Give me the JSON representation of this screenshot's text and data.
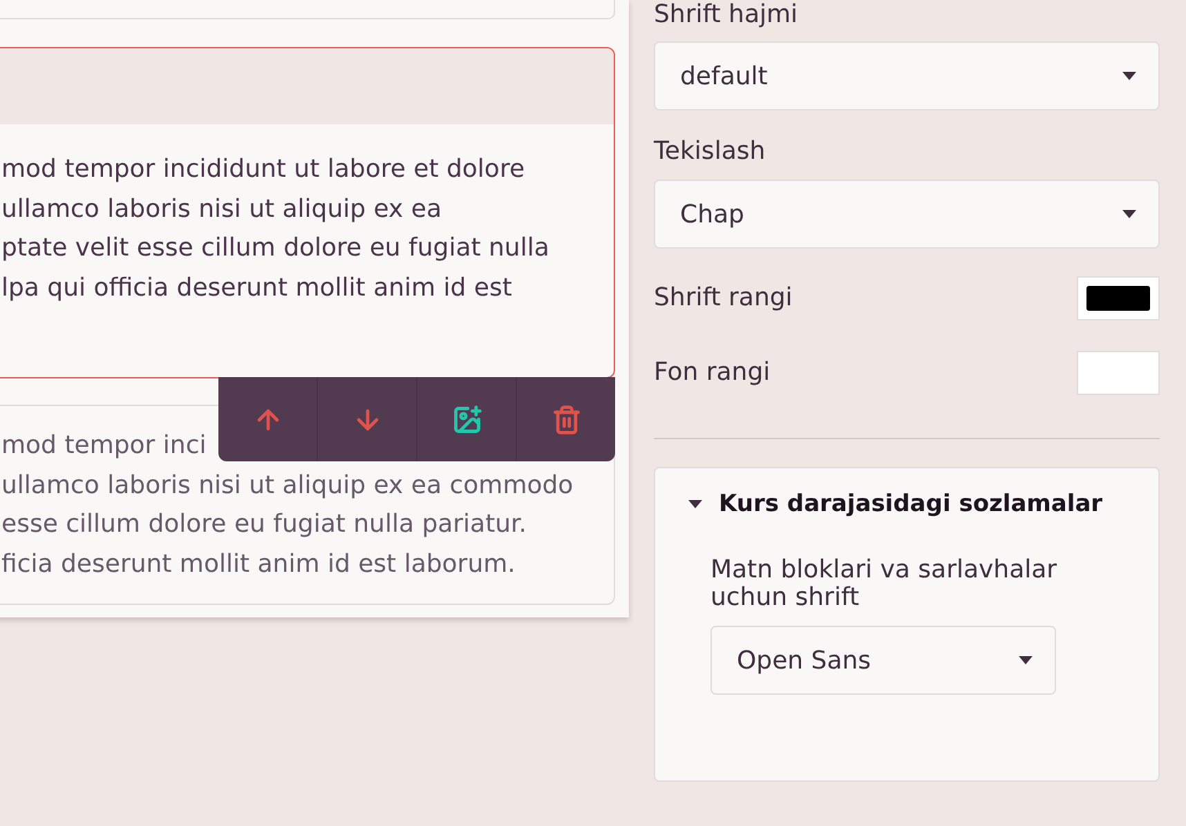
{
  "blocks": [
    {
      "selected": true,
      "lines": [
        "mod tempor incididunt ut labore et dolore",
        "ullamco laboris nisi ut aliquip ex ea",
        "ptate velit esse cillum dolore eu fugiat nulla",
        "lpa qui officia deserunt mollit anim id est"
      ]
    },
    {
      "selected": false,
      "lines": [
        "mod tempor inci",
        "ullamco laboris nisi ut aliquip ex ea commodo",
        "esse cillum dolore eu fugiat nulla pariatur.",
        "ficia deserunt mollit anim id est laborum."
      ]
    }
  ],
  "block_toolbar": [
    {
      "kind": "up"
    },
    {
      "kind": "down"
    },
    {
      "kind": "add-image"
    },
    {
      "kind": "delete"
    }
  ],
  "font_size": {
    "label": "Shrift hajmi",
    "value": "default"
  },
  "alignment": {
    "label": "Tekislash",
    "value": "Chap"
  },
  "font_color": {
    "label": "Shrift rangi",
    "color": "#000000"
  },
  "background_color": {
    "label": "Fon rangi",
    "color": "#ffffff"
  },
  "course_settings": {
    "title": "Kurs darajasidagi sozlamalar",
    "expanded": true,
    "font_label": "Matn bloklari va sarlavhalar uchun shrift",
    "font_value": "Open Sans"
  }
}
